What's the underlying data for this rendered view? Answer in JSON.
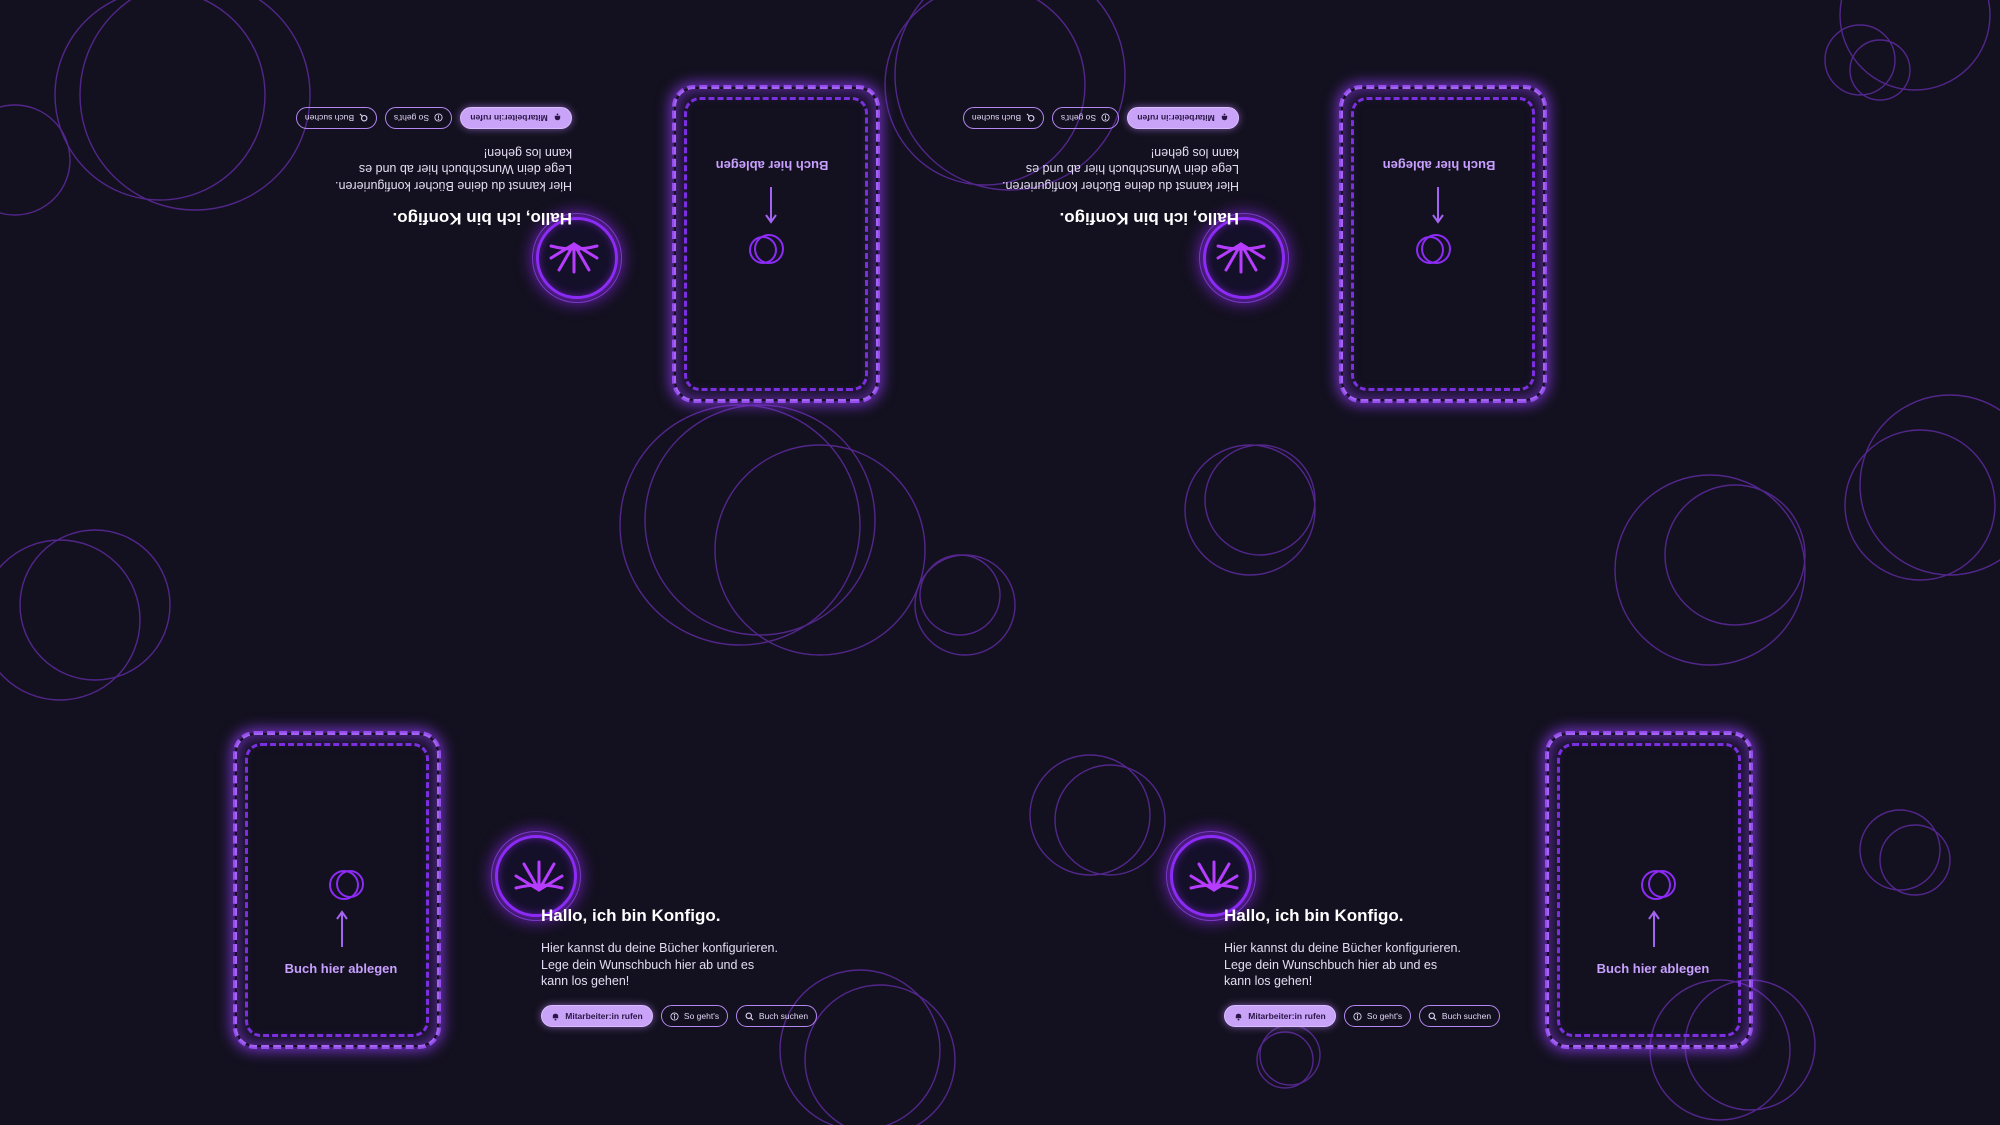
{
  "colors": {
    "background": "#13111f",
    "accent": "#9b3cff",
    "accent_light": "#c8a3f7",
    "text": "#ffffff"
  },
  "stations": [
    {
      "id": "top-left",
      "flipped": true,
      "drop_label": "Buch hier ablegen",
      "greeting": "Hallo, ich bin Konfigo.",
      "intro_lines": [
        "Hier kannst du deine Bücher konfigurieren.",
        "Lege dein Wunschbuch hier ab und es",
        "kann los gehen!"
      ],
      "buttons": [
        {
          "label": "Mitarbeiter:in rufen",
          "icon": "bell-icon",
          "primary": true
        },
        {
          "label": "So geht's",
          "icon": "info-icon",
          "primary": false
        },
        {
          "label": "Buch suchen",
          "icon": "search-icon",
          "primary": false
        }
      ]
    },
    {
      "id": "top-right",
      "flipped": true,
      "drop_label": "Buch hier ablegen",
      "greeting": "Hallo, ich bin Konfigo.",
      "intro_lines": [
        "Hier kannst du deine Bücher konfigurieren.",
        "Lege dein Wunschbuch hier ab und es",
        "kann los gehen!"
      ],
      "buttons": [
        {
          "label": "Mitarbeiter:in rufen",
          "icon": "bell-icon",
          "primary": true
        },
        {
          "label": "So geht's",
          "icon": "info-icon",
          "primary": false
        },
        {
          "label": "Buch suchen",
          "icon": "search-icon",
          "primary": false
        }
      ]
    },
    {
      "id": "bottom-left",
      "flipped": false,
      "drop_label": "Buch hier ablegen",
      "greeting": "Hallo, ich bin Konfigo.",
      "intro_lines": [
        "Hier kannst du deine Bücher konfigurieren.",
        "Lege dein Wunschbuch hier ab und es",
        "kann los gehen!"
      ],
      "buttons": [
        {
          "label": "Mitarbeiter:in rufen",
          "icon": "bell-icon",
          "primary": true
        },
        {
          "label": "So geht's",
          "icon": "info-icon",
          "primary": false
        },
        {
          "label": "Buch suchen",
          "icon": "search-icon",
          "primary": false
        }
      ]
    },
    {
      "id": "bottom-right",
      "flipped": false,
      "drop_label": "Buch hier ablegen",
      "greeting": "Hallo, ich bin Konfigo.",
      "intro_lines": [
        "Hier kannst du deine Bücher konfigurieren.",
        "Lege dein Wunschbuch hier ab und es",
        "kann los gehen!"
      ],
      "buttons": [
        {
          "label": "Mitarbeiter:in rufen",
          "icon": "bell-icon",
          "primary": true
        },
        {
          "label": "So geht's",
          "icon": "info-icon",
          "primary": false
        },
        {
          "label": "Buch suchen",
          "icon": "search-icon",
          "primary": false
        }
      ]
    }
  ]
}
